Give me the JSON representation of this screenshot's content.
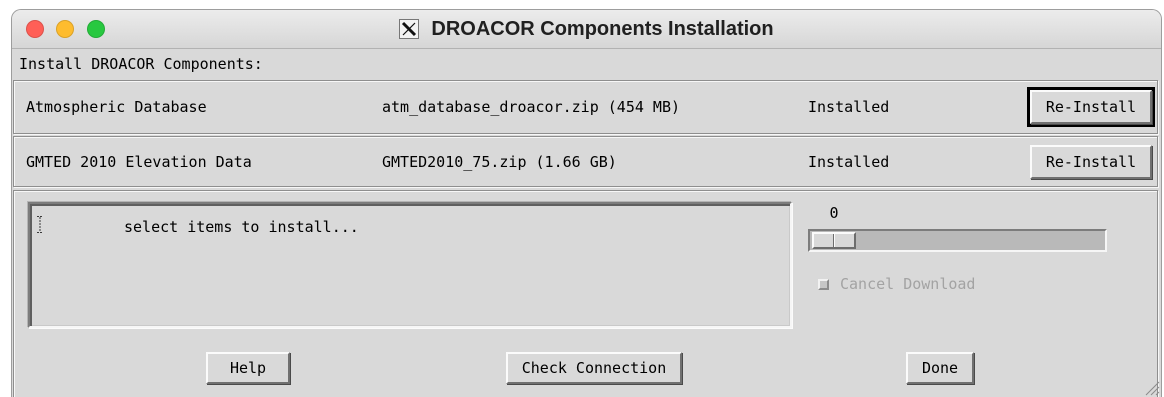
{
  "window": {
    "title": "DROACOR Components Installation",
    "title_icon": "x11-icon",
    "traffic_lights": {
      "close": "#ff5f57",
      "minimize": "#febc2e",
      "zoom": "#28c840"
    }
  },
  "colors": {
    "background": "#d9d9d9",
    "disabled_text": "#a3a3a3",
    "text": "#000000"
  },
  "header": {
    "label": "Install DROACOR Components:"
  },
  "components": [
    {
      "name": "Atmospheric Database",
      "file": "atm_database_droacor.zip (454 MB)",
      "status": "Installed",
      "action_label": "Re-Install",
      "default_button": true
    },
    {
      "name": "GMTED 2010 Elevation Data",
      "file": "GMTED2010_75.zip (1.66 GB)",
      "status": "Installed",
      "action_label": "Re-Install",
      "default_button": false
    }
  ],
  "log": {
    "text": "select items to install...",
    "cursor_icon": "text-cursor-icon"
  },
  "download": {
    "progress_value": 0,
    "cancel_label": "Cancel Download",
    "cancel_checked": false,
    "cancel_enabled": false
  },
  "buttons": {
    "help": "Help",
    "check_connection": "Check Connection",
    "done": "Done"
  },
  "icons": {
    "resize_grip": "resize-grip-icon"
  }
}
